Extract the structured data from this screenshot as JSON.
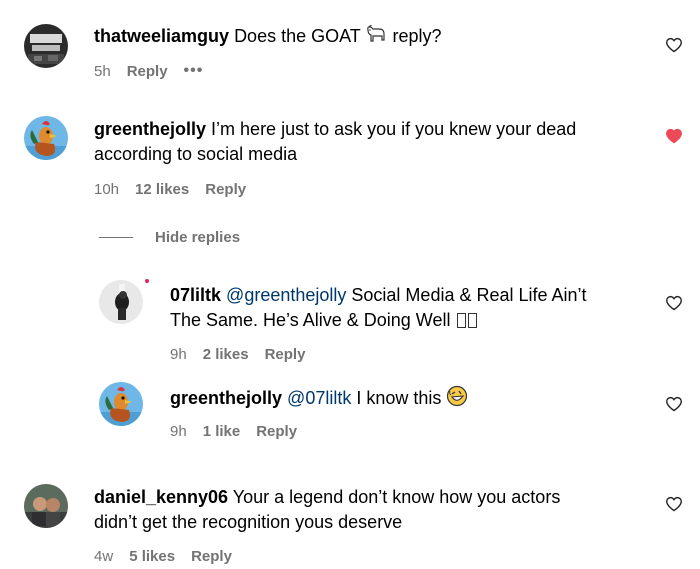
{
  "comments": [
    {
      "username": "thatweeliamguy",
      "text": "Does the GOAT",
      "text_after": "reply?",
      "time": "5h",
      "reply_label": "Reply",
      "more": "•••",
      "liked": false
    },
    {
      "username": "greenthejolly",
      "text": "I’m here just to ask you if you knew your dead",
      "text_line2": "according to social media",
      "time": "10h",
      "likes": "12 likes",
      "reply_label": "Reply",
      "liked": true,
      "heart_color": "#ed4956"
    },
    {
      "username": "07liltk",
      "mention": "@greenthejolly",
      "text": "Social Media & Real Life Ain’t",
      "text_line2": "The Same. He’s Alive & Doing Well",
      "time": "9h",
      "likes": "2 likes",
      "reply_label": "Reply",
      "liked": false
    },
    {
      "username": "greenthejolly",
      "mention": "@07liltk",
      "text": "I know this",
      "time": "9h",
      "likes": "1 like",
      "reply_label": "Reply",
      "liked": false
    },
    {
      "username": "daniel_kenny06",
      "text": "Your a legend don’t know how you actors",
      "text_line2": "didn’t get the recognition yous deserve",
      "time": "4w",
      "likes": "5 likes",
      "reply_label": "Reply",
      "liked": false
    }
  ],
  "hide_replies_label": "Hide replies",
  "colors": {
    "text": "#000000",
    "muted": "#737373",
    "mention": "#00376b",
    "heart_liked": "#ed4956"
  },
  "icons": {
    "goat": "goat-emoji-icon",
    "rofl": "rolling-laughing-emoji-icon",
    "heart": "heart-icon"
  }
}
